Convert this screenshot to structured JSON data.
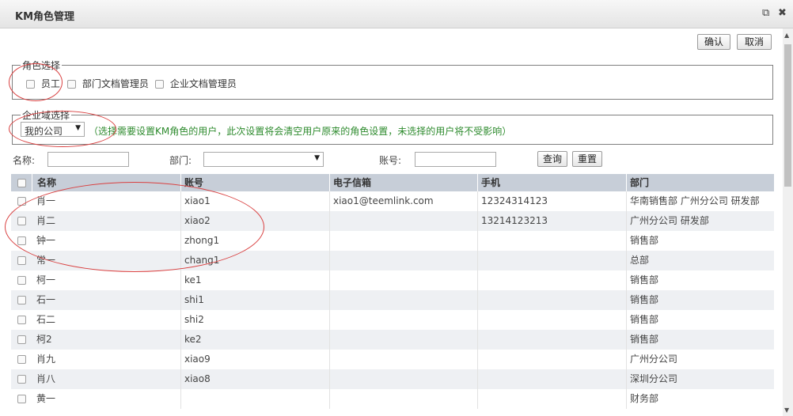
{
  "window": {
    "title": "KM角色管理",
    "popout_icon": "external-link-icon",
    "close_icon": "close-icon"
  },
  "actions": {
    "confirm_label": "确认",
    "cancel_label": "取消"
  },
  "role_section": {
    "legend": "角色选择",
    "roles": [
      "员工",
      "部门文档管理员",
      "企业文档管理员"
    ]
  },
  "domain_section": {
    "legend": "企业域选择",
    "selected": "我的公司",
    "hint": "（选择需要设置KM角色的用户，此次设置将会清空用户原来的角色设置，未选择的用户将不受影响）"
  },
  "filters": {
    "name_label": "名称:",
    "dept_label": "部门:",
    "account_label": "账号:",
    "query_label": "查询",
    "reset_label": "重置"
  },
  "table": {
    "headers": [
      "名称",
      "账号",
      "电子信箱",
      "手机",
      "部门"
    ],
    "rows": [
      {
        "name": "肖一",
        "account": "xiao1",
        "email": "xiao1@teemlink.com",
        "phone": "12324314123",
        "dept": "华南销售部 广州分公司 研发部"
      },
      {
        "name": "肖二",
        "account": "xiao2",
        "email": "",
        "phone": "13214123213",
        "dept": "广州分公司 研发部"
      },
      {
        "name": "钟一",
        "account": "zhong1",
        "email": "",
        "phone": "",
        "dept": "销售部"
      },
      {
        "name": "常一",
        "account": "chang1",
        "email": "",
        "phone": "",
        "dept": "总部"
      },
      {
        "name": "柯一",
        "account": "ke1",
        "email": "",
        "phone": "",
        "dept": "销售部"
      },
      {
        "name": "石一",
        "account": "shi1",
        "email": "",
        "phone": "",
        "dept": "销售部"
      },
      {
        "name": "石二",
        "account": "shi2",
        "email": "",
        "phone": "",
        "dept": "销售部"
      },
      {
        "name": "柯2",
        "account": "ke2",
        "email": "",
        "phone": "",
        "dept": "销售部"
      },
      {
        "name": "肖九",
        "account": "xiao9",
        "email": "",
        "phone": "",
        "dept": "广州分公司"
      },
      {
        "name": "肖八",
        "account": "xiao8",
        "email": "",
        "phone": "",
        "dept": "深圳分公司"
      },
      {
        "name": "黄一",
        "account": "",
        "email": "",
        "phone": "",
        "dept": "财务部"
      }
    ]
  },
  "colors": {
    "header_bg": "#c7ced8",
    "hint_text": "#2e8b2e",
    "annotation": "#d94040"
  }
}
